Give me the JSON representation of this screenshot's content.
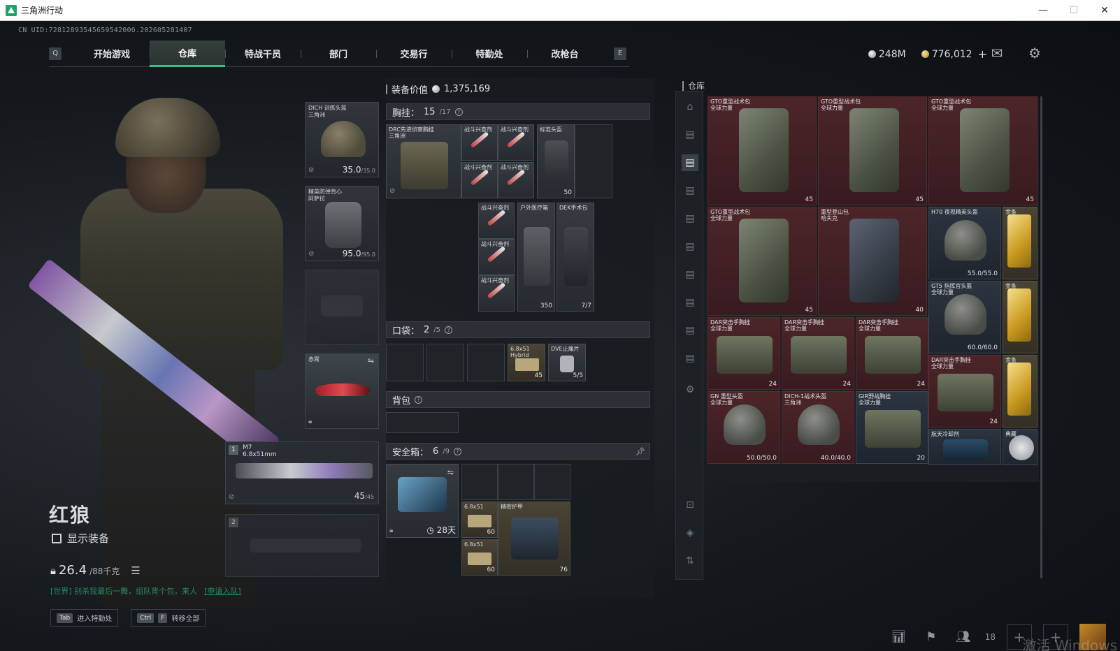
{
  "window": {
    "title": "三角洲行动",
    "minimize": "—",
    "maximize": "☐",
    "close": "✕"
  },
  "uid": "CN UID:7281289354565954200б.202605281407",
  "nav": {
    "left_key": "Q",
    "right_key": "E",
    "tabs": [
      "开始游戏",
      "仓库",
      "特战干员",
      "部门",
      "交易行",
      "特勤处",
      "改枪台"
    ],
    "active_index": 1
  },
  "currency": {
    "silver": "248M",
    "gold": "776,012",
    "plus": "+"
  },
  "operator": {
    "name": "红狼",
    "show_gear_label": "显示装备",
    "weight": "26.4",
    "weight_max": "/88千克"
  },
  "chat": {
    "text": "[世界] 别杀我最后一舞，组队背个包，来人",
    "apply": "[申请入队]"
  },
  "bottom_keys": [
    {
      "key": "Tab",
      "label": "进入特勤处"
    },
    {
      "key": "Ctrl",
      "key2": "F",
      "label": "转移全部"
    }
  ],
  "equipment": {
    "helmet": {
      "name": "DICH 训练头盔",
      "sub": "三角洲",
      "dur": "35.0",
      "max": "/35.0"
    },
    "armor": {
      "name": "精英防弹背心",
      "sub": "阿萨拉",
      "dur": "95.0",
      "max": "/95.0"
    },
    "melee": {
      "name": "赤霄"
    },
    "primary": {
      "num": "1",
      "name": "M7",
      "caliber": "6.8x51mm",
      "ammo": "45",
      "ammo_max": "/45"
    },
    "secondary": {
      "num": "2"
    }
  },
  "mid": {
    "equip_value_label": "装备价值",
    "equip_value": "1,375,169",
    "chest": {
      "label": "胸挂：",
      "count": "15",
      "cap": "/17",
      "rig_name": "DRC先进侦察胸挂",
      "rig_sub": "三角洲"
    },
    "chest_items": [
      {
        "label": "战斗兴奋剂"
      },
      {
        "label": "战斗兴奋剂"
      },
      {
        "label": "战斗兴奋剂"
      },
      {
        "label": "战斗兴奋剂"
      },
      {
        "label": "标准头盔",
        "count": "50"
      },
      {
        "label": "战斗兴奋剂"
      },
      {
        "label": "战斗兴奋剂"
      },
      {
        "label": "战斗兴奋剂"
      },
      {
        "label": "户外医疗箱",
        "count": "350"
      },
      {
        "label": "DEK手术包",
        "count": "7/7"
      }
    ],
    "pocket": {
      "label": "口袋：",
      "count": "2",
      "cap": "/5"
    },
    "pocket_items": [
      {
        "label": "6.8x51 Hybrid",
        "count": "45"
      },
      {
        "label": "DVE止痛片",
        "count": "5/5"
      }
    ],
    "backpack": {
      "label": "背包"
    },
    "safe": {
      "label": "安全箱：",
      "count": "6",
      "cap": "/9",
      "days": "28天"
    },
    "safe_items": [
      {
        "label": "6.8x51",
        "count": "60"
      },
      {
        "label": "精密护甲",
        "count": "76"
      },
      {
        "label": "6.8x51",
        "count": "60"
      }
    ]
  },
  "warehouse": {
    "title": "仓库",
    "items": [
      {
        "name": "GTO重型战术包",
        "sub": "全球力量",
        "count": "45"
      },
      {
        "name": "GTO重型战术包",
        "sub": "全球力量",
        "count": "45"
      },
      {
        "name": "GTO重型战术包",
        "sub": "全球力量",
        "count": "45"
      },
      {
        "name": "GTO重型战术包",
        "sub": "全球力量",
        "count": "45"
      },
      {
        "name": "重型登山包",
        "sub": "哈夫克",
        "count": "40"
      },
      {
        "name": "H70 夜视精英头盔",
        "dur": "55.0/55.0"
      },
      {
        "name": "金条"
      },
      {
        "name": "GT5 指挥官头盔",
        "sub": "全球力量",
        "dur": "60.0/60.0"
      },
      {
        "name": "金条"
      },
      {
        "name": "DAR突击手胸挂",
        "sub": "全球力量",
        "count": "24"
      },
      {
        "name": "DAR突击手胸挂",
        "sub": "全球力量",
        "count": "24"
      },
      {
        "name": "DAR突击手胸挂",
        "sub": "全球力量",
        "count": "24"
      },
      {
        "name": "DAR突击手胸挂",
        "sub": "全球力量",
        "count": "24"
      },
      {
        "name": "金条"
      },
      {
        "name": "GN 重型头盔",
        "sub": "全球力量",
        "dur": "50.0/50.0"
      },
      {
        "name": "DICH-1战术头盔",
        "sub": "三角洲",
        "dur": "40.0/40.0"
      },
      {
        "name": "GIR野战胸挂",
        "sub": "全球力量",
        "count": "20"
      },
      {
        "name": "航天冷却剂"
      },
      {
        "name": "典藏"
      }
    ]
  },
  "bottom_right": {
    "friends_count": "18",
    "watermark": "激活 Windows"
  }
}
